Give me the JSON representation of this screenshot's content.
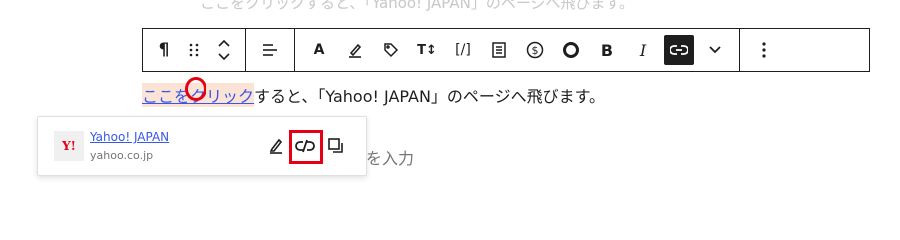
{
  "faded_line": "ここをクリックすると、「Yahoo! JAPAN」のページへ飛びます。",
  "toolbar": {
    "paragraph_icon": "pilcrow-icon",
    "drag_icon": "drag-handle-icon",
    "move_icon": "move-up-down-icon",
    "align_icon": "align-icon",
    "text_color_icon": "text-color-icon",
    "highlight_icon": "highlight-icon",
    "tag_icon": "tag-icon",
    "font_size_icon": "font-size-icon",
    "code_icon": "code-icon",
    "block_icon": "block-icon",
    "dollar_icon": "dollar-icon",
    "circle_icon": "circle-icon",
    "bold_label": "B",
    "italic_label": "I",
    "link_icon": "link-icon",
    "more_rich_icon": "chevron-down-icon",
    "options_icon": "more-options-icon"
  },
  "paragraph": {
    "link_part1": "ここを",
    "link_part2": "ク",
    "link_part3": "リック",
    "rest": "すると、「Yahoo! JAPAN」のページへ飛びます。"
  },
  "placeholder_tail": "を入力",
  "link_popover": {
    "favicon_text": "Y!",
    "title": "Yahoo! JAPAN",
    "url": "yahoo.co.jp",
    "edit_icon": "pencil-icon",
    "unlink_icon": "unlink-icon",
    "copy_icon": "copy-icon"
  },
  "colors": {
    "link": "#3858e9",
    "highlight": "#fbe3d6",
    "annotation_red": "#e60012"
  }
}
